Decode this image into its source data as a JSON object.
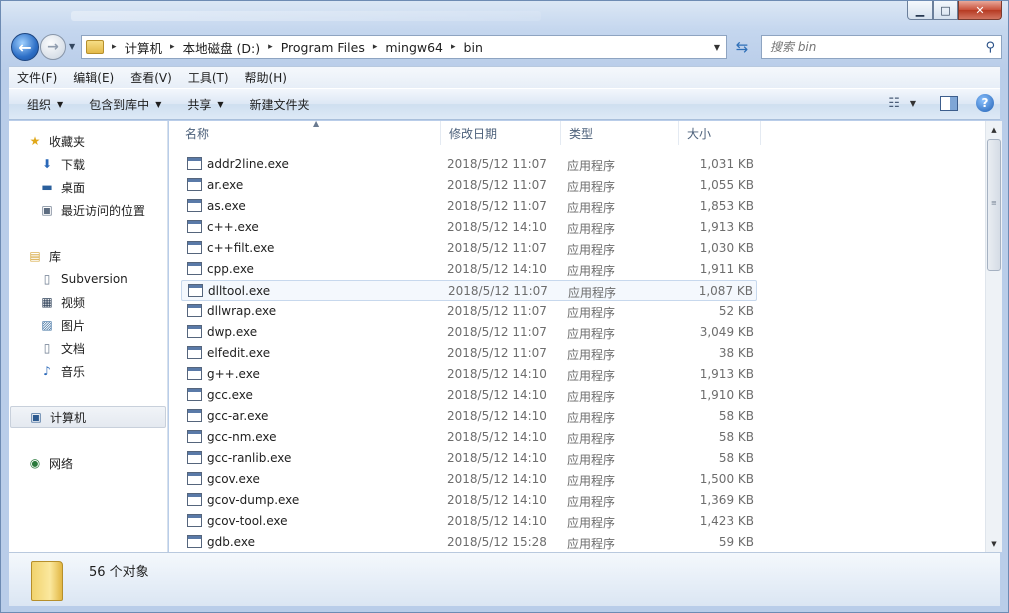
{
  "window": {
    "caption": {
      "minimize": "▁",
      "maximize": "□",
      "close": "✕"
    }
  },
  "address": {
    "breadcrumbs": [
      "计算机",
      "本地磁盘 (D:)",
      "Program Files",
      "mingw64",
      "bin"
    ]
  },
  "search": {
    "placeholder": "搜索 bin"
  },
  "menu": [
    "文件(F)",
    "编辑(E)",
    "查看(V)",
    "工具(T)",
    "帮助(H)"
  ],
  "commands": [
    "组织",
    "包含到库中",
    "共享",
    "新建文件夹"
  ],
  "nav": {
    "favorites": {
      "label": "收藏夹",
      "icon": "star-icon"
    },
    "favorites_items": [
      {
        "label": "下载",
        "icon": "downloads-icon"
      },
      {
        "label": "桌面",
        "icon": "desktop-icon"
      },
      {
        "label": "最近访问的位置",
        "icon": "recent-places-icon"
      }
    ],
    "libraries": {
      "label": "库",
      "icon": "library-icon"
    },
    "library_items": [
      {
        "label": "Subversion",
        "icon": "document-icon"
      },
      {
        "label": "视频",
        "icon": "video-icon"
      },
      {
        "label": "图片",
        "icon": "picture-icon"
      },
      {
        "label": "文档",
        "icon": "document-icon"
      },
      {
        "label": "音乐",
        "icon": "music-icon"
      }
    ],
    "computer": {
      "label": "计算机",
      "icon": "computer-icon"
    },
    "network": {
      "label": "网络",
      "icon": "network-icon"
    }
  },
  "columns": {
    "name": "名称",
    "date": "修改日期",
    "type": "类型",
    "size": "大小"
  },
  "files": [
    {
      "name": "addr2line.exe",
      "date": "2018/5/12 11:07",
      "type": "应用程序",
      "size": "1,031 KB"
    },
    {
      "name": "ar.exe",
      "date": "2018/5/12 11:07",
      "type": "应用程序",
      "size": "1,055 KB"
    },
    {
      "name": "as.exe",
      "date": "2018/5/12 11:07",
      "type": "应用程序",
      "size": "1,853 KB"
    },
    {
      "name": "c++.exe",
      "date": "2018/5/12 14:10",
      "type": "应用程序",
      "size": "1,913 KB"
    },
    {
      "name": "c++filt.exe",
      "date": "2018/5/12 11:07",
      "type": "应用程序",
      "size": "1,030 KB"
    },
    {
      "name": "cpp.exe",
      "date": "2018/5/12 14:10",
      "type": "应用程序",
      "size": "1,911 KB"
    },
    {
      "name": "dlltool.exe",
      "date": "2018/5/12 11:07",
      "type": "应用程序",
      "size": "1,087 KB"
    },
    {
      "name": "dllwrap.exe",
      "date": "2018/5/12 11:07",
      "type": "应用程序",
      "size": "52 KB"
    },
    {
      "name": "dwp.exe",
      "date": "2018/5/12 11:07",
      "type": "应用程序",
      "size": "3,049 KB"
    },
    {
      "name": "elfedit.exe",
      "date": "2018/5/12 11:07",
      "type": "应用程序",
      "size": "38 KB"
    },
    {
      "name": "g++.exe",
      "date": "2018/5/12 14:10",
      "type": "应用程序",
      "size": "1,913 KB"
    },
    {
      "name": "gcc.exe",
      "date": "2018/5/12 14:10",
      "type": "应用程序",
      "size": "1,910 KB"
    },
    {
      "name": "gcc-ar.exe",
      "date": "2018/5/12 14:10",
      "type": "应用程序",
      "size": "58 KB"
    },
    {
      "name": "gcc-nm.exe",
      "date": "2018/5/12 14:10",
      "type": "应用程序",
      "size": "58 KB"
    },
    {
      "name": "gcc-ranlib.exe",
      "date": "2018/5/12 14:10",
      "type": "应用程序",
      "size": "58 KB"
    },
    {
      "name": "gcov.exe",
      "date": "2018/5/12 14:10",
      "type": "应用程序",
      "size": "1,500 KB"
    },
    {
      "name": "gcov-dump.exe",
      "date": "2018/5/12 14:10",
      "type": "应用程序",
      "size": "1,369 KB"
    },
    {
      "name": "gcov-tool.exe",
      "date": "2018/5/12 14:10",
      "type": "应用程序",
      "size": "1,423 KB"
    },
    {
      "name": "gdb.exe",
      "date": "2018/5/12 15:28",
      "type": "应用程序",
      "size": "59 KB"
    }
  ],
  "hovered_file": "dlltool.exe",
  "details": {
    "count": "56 个对象"
  },
  "colors": {
    "accent": "#2d6fc6",
    "close": "#c8503a",
    "selection": "#c7d8ed"
  }
}
